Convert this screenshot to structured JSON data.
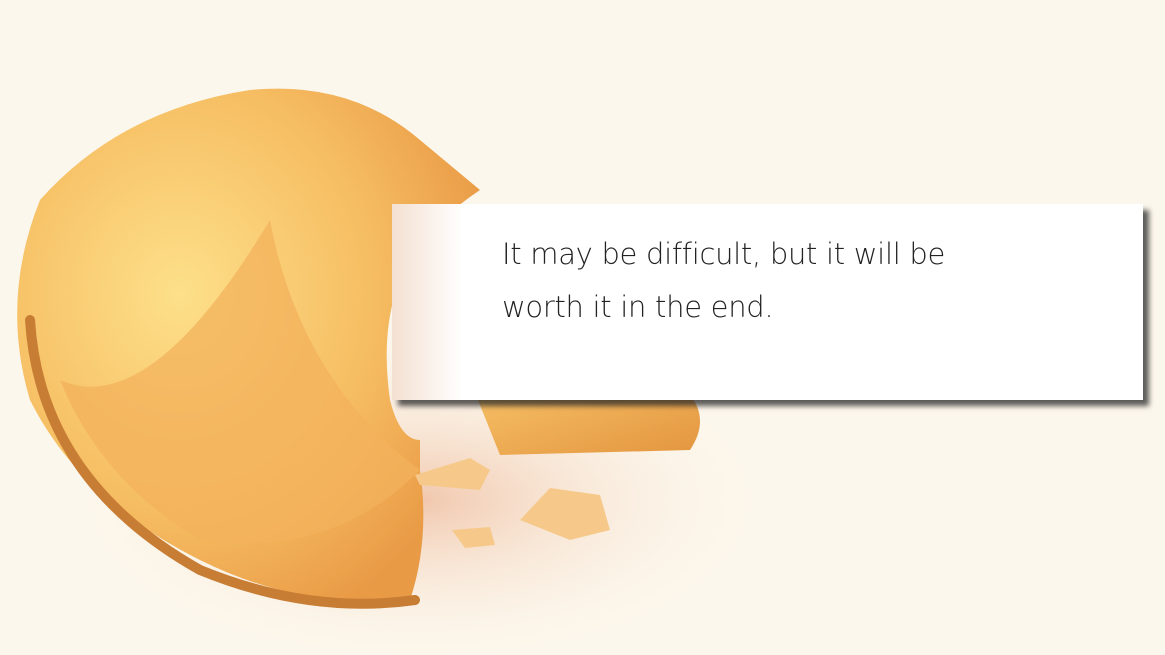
{
  "fortune": {
    "message": "It may be difficult, but it will be worth it in the end."
  },
  "colors": {
    "background": "#fcf7ec",
    "cookie": "#f4b35a",
    "paper": "#ffffff",
    "text": "#222222"
  }
}
